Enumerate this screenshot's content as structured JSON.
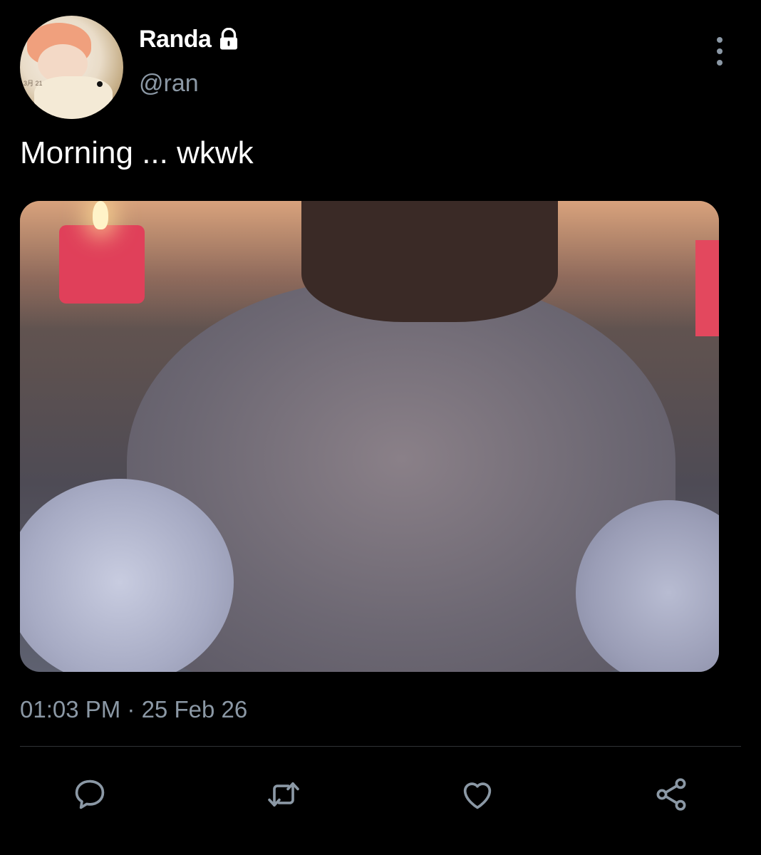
{
  "user": {
    "display_name": "Randa",
    "handle": "@ran",
    "protected_icon": "lock-icon",
    "avatar_badge_text": "3月 21"
  },
  "tweet": {
    "text": "Morning ... wkwk",
    "media_alt": "photo",
    "timestamp": "01:03 PM · 25 Feb 26"
  },
  "actions": [
    {
      "name": "reply",
      "icon": "comment-icon"
    },
    {
      "name": "retweet",
      "icon": "retweet-icon"
    },
    {
      "name": "like",
      "icon": "heart-icon"
    },
    {
      "name": "share",
      "icon": "share-icon"
    }
  ],
  "colors": {
    "background": "#000000",
    "primary_text": "#ffffff",
    "secondary_text": "#8b98a5",
    "divider": "#2f3336"
  }
}
